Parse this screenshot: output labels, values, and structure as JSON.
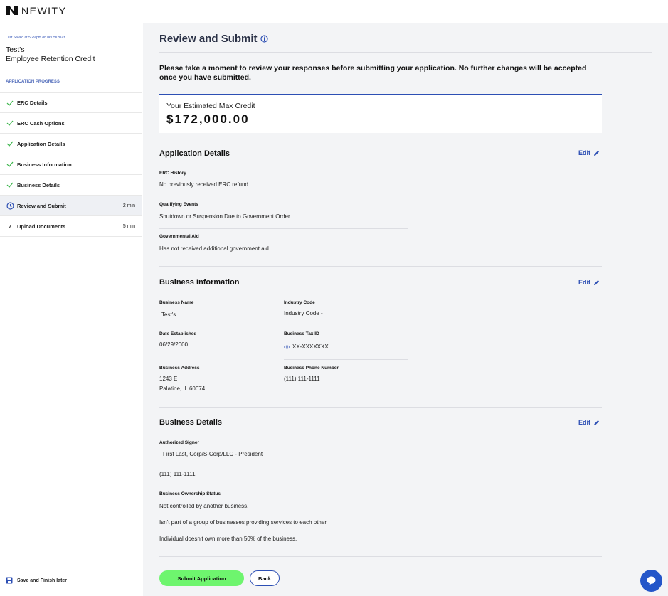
{
  "brand": {
    "name": "NEWITY"
  },
  "sidebar": {
    "last_saved": "Last Saved at 5:29 pm on 06/29/2023",
    "app_business": "Test's",
    "app_type": "Employee Retention Credit",
    "progress_heading": "APPLICATION PROGRESS",
    "steps": [
      {
        "label": "ERC Details",
        "status": "complete",
        "icon": "check-icon"
      },
      {
        "label": "ERC Cash Options",
        "status": "complete",
        "icon": "check-icon"
      },
      {
        "label": "Application Details",
        "status": "complete",
        "icon": "check-icon"
      },
      {
        "label": "Business Information",
        "status": "complete",
        "icon": "check-icon"
      },
      {
        "label": "Business Details",
        "status": "complete",
        "icon": "check-icon"
      },
      {
        "label": "Review and Submit",
        "status": "active",
        "icon": "clock-icon",
        "time": "2 min"
      },
      {
        "label": "Upload Documents",
        "status": "pending",
        "number": "7",
        "time": "5 min"
      }
    ],
    "save_later": "Save and Finish later"
  },
  "main": {
    "title": "Review and Submit",
    "intro": "Please take a moment to review your responses before submitting your application. No further changes will be accepted once you have submitted.",
    "credit": {
      "label": "Your Estimated Max Credit",
      "value": "$172,000.00"
    },
    "edit_label": "Edit",
    "application_details": {
      "title": "Application Details",
      "erc_history_label": "ERC History",
      "erc_history_value": "No previously received ERC refund.",
      "qualifying_label": "Qualifying Events",
      "qualifying_value": "Shutdown or Suspension Due to Government Order",
      "aid_label": "Governmental Aid",
      "aid_value": "Has not received additional government aid."
    },
    "business_information": {
      "title": "Business Information",
      "name_label": "Business Name",
      "name_value": "Test's",
      "industry_label": "Industry Code",
      "industry_value": "Industry Code -",
      "date_label": "Date Established",
      "date_value": "06/29/2000",
      "taxid_label": "Business Tax ID",
      "taxid_value": "XX-XXXXXXX",
      "address_label": "Business Address",
      "address_line1": "1243 E",
      "address_line2": "Palatine, IL 60074",
      "phone_label": "Business Phone Number",
      "phone_value": "(111) 111-1111"
    },
    "business_details": {
      "title": "Business Details",
      "signer_label": "Authorized Signer",
      "signer_value": "First Last, Corp/S-Corp/LLC - President",
      "signer_phone": "(111) 111-1111",
      "ownership_label": "Business Ownership Status",
      "ownership_1": "Not controlled by another business.",
      "ownership_2": "Isn't part of a group of businesses providing services to each other.",
      "ownership_3": "Individual doesn't own more than 50% of the business."
    },
    "submit_label": "Submit Application",
    "back_label": "Back"
  },
  "colors": {
    "accent": "#2d4fb4",
    "submit": "#6ef56e",
    "check": "#3bb54a",
    "chat": "#2456c9"
  }
}
